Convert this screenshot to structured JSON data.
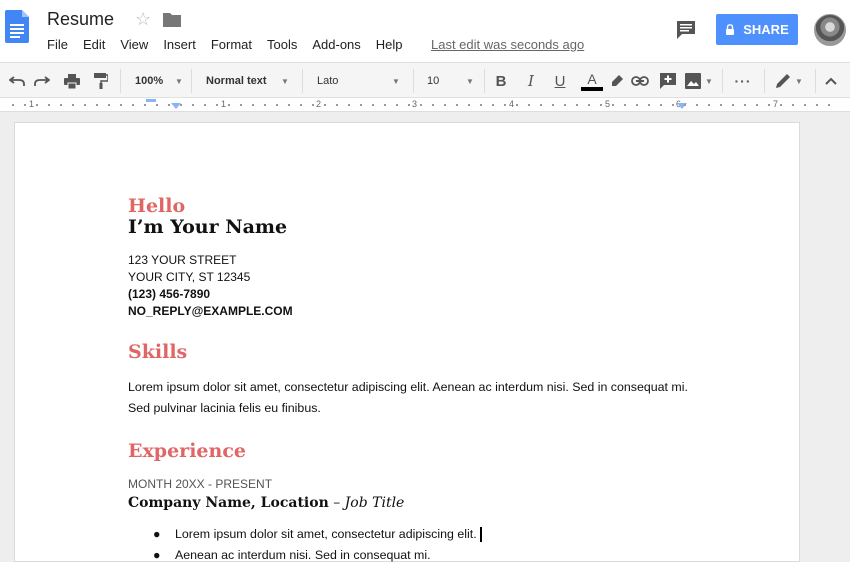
{
  "header": {
    "title": "Resume",
    "menu": [
      "File",
      "Edit",
      "View",
      "Insert",
      "Format",
      "Tools",
      "Add-ons",
      "Help"
    ],
    "last_edit": "Last edit was seconds ago",
    "share_label": "SHARE"
  },
  "toolbar": {
    "zoom": "100%",
    "style": "Normal text",
    "font": "Lato",
    "font_size": "10"
  },
  "ruler": {
    "numbers": [
      "1",
      "1",
      "2",
      "3",
      "4",
      "5",
      "6",
      "7"
    ]
  },
  "document": {
    "greeting": "Hello",
    "name": "I’m Your Name",
    "street": "123 YOUR STREET",
    "city": "YOUR CITY, ST 12345",
    "phone": "(123) 456-7890",
    "email": "NO_REPLY@EXAMPLE.COM",
    "skills_heading": "Skills",
    "skills_text": "Lorem ipsum dolor sit amet, consectetur adipiscing elit. Aenean ac interdum nisi. Sed in consequat mi. Sed pulvinar lacinia felis eu finibus.",
    "experience_heading": "Experience",
    "job_dates": "MONTH 20XX - PRESENT",
    "company": "Company Name, Location",
    "job_title_sep": " – ",
    "job_title": "Job Title",
    "bullets": [
      "Lorem ipsum dolor sit amet, consectetur adipiscing elit.",
      "Aenean ac interdum nisi. Sed in consequat mi."
    ]
  },
  "colors": {
    "accent": "#e06666",
    "share_button": "#4d90fe",
    "doc_icon": "#4285f4"
  },
  "icons": [
    "docs-icon",
    "star-icon",
    "folder-icon",
    "comments-icon",
    "lock-icon",
    "undo-icon",
    "redo-icon",
    "print-icon",
    "paint-format-icon",
    "bold-icon",
    "italic-icon",
    "underline-icon",
    "text-color-icon",
    "highlight-icon",
    "link-icon",
    "add-comment-icon",
    "image-icon",
    "more-icon",
    "edit-mode-icon",
    "collapse-icon"
  ]
}
